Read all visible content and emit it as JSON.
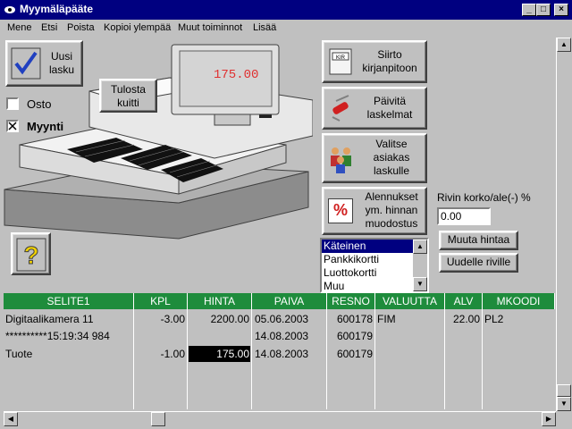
{
  "window": {
    "title": "Myymäläpääte",
    "minimize": "_",
    "maximize": "□",
    "close": "×"
  },
  "menu": [
    "Mene",
    "Etsi",
    "Poista",
    "Kopioi ylempää",
    "Muut toiminnot",
    "Lisää"
  ],
  "left": {
    "new_invoice": "Uusi lasku",
    "print_receipt": "Tulosta kuitti",
    "purchase_label": "Osto",
    "purchase_checked": false,
    "sale_label": "Myynti",
    "sale_checked": true
  },
  "register": {
    "display": "175.00"
  },
  "actions": {
    "transfer": "Siirto kirjanpitoon",
    "transfer_icon_text": "KIR",
    "update": "Päivitä laskelmat",
    "select_customer": "Valitse asiakas laskulle",
    "discounts": "Alennukset ym. hinnan muodostus",
    "discount_icon_text": "%"
  },
  "discount": {
    "label": "Rivin korko/ale(-) %",
    "value": "0.00"
  },
  "price_buttons": {
    "change": "Muuta hintaa",
    "new_row": "Uudelle riville"
  },
  "payment_methods": {
    "items": [
      "Käteinen",
      "Pankkikortti",
      "Luottokortti",
      "Muu"
    ],
    "selected": 0
  },
  "table": {
    "columns": [
      "SELITE1",
      "KPL",
      "HINTA",
      "PAIVA",
      "RESNO",
      "VALUUTTA",
      "ALV",
      "MKOODI"
    ],
    "rows": [
      [
        "Digitaalikamera 11",
        "-3.00",
        "2200.00",
        "05.06.2003",
        "600178",
        "FIM",
        "22.00",
        "PL2"
      ],
      [
        "**********15:19:34  984",
        "",
        "",
        "14.08.2003",
        "600179",
        "",
        "",
        ""
      ],
      [
        "Tuote",
        "-1.00",
        "175.00",
        "14.08.2003",
        "600179",
        "",
        "",
        ""
      ]
    ]
  }
}
